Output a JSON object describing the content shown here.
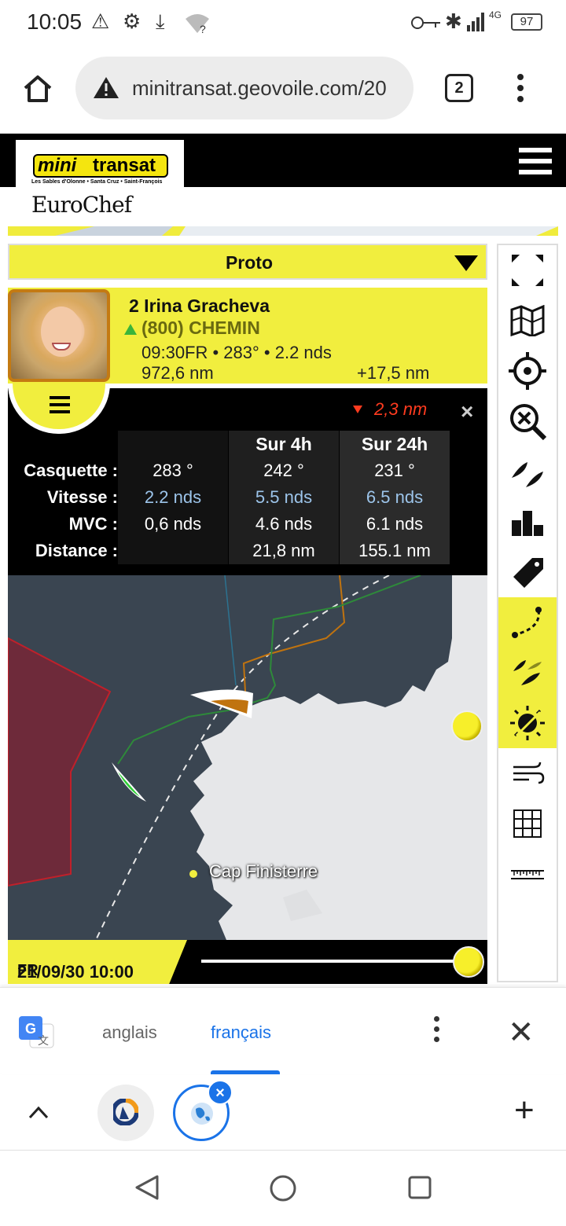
{
  "status_bar": {
    "time": "10:05",
    "battery": "97",
    "network": "4G"
  },
  "browser": {
    "url": "minitransat.geovoile.com/20",
    "tab_count": "2"
  },
  "site": {
    "logo_mini": "mini",
    "logo_transat": "transat",
    "logo_tagline": "Les Sables d'Olonne • Santa Cruz • Saint-François",
    "logo_sponsor": "EuroChef"
  },
  "class_selector": {
    "selected": "Proto"
  },
  "skipper": {
    "rank_name": "2 Irina Gracheva",
    "boat": "(800) CHEMIN",
    "position_line": "09:30FR • 283° • 2.2 nds",
    "distance": "972,6 nm",
    "gain": "+17,5 nm"
  },
  "stats": {
    "delta": "2,3 nm",
    "close": "×",
    "headers": [
      "",
      "Sur 4h",
      "Sur 24h"
    ],
    "rows": [
      {
        "label": "Casquette :",
        "values": [
          "283 °",
          "242 °",
          "231 °"
        ]
      },
      {
        "label": "Vitesse :",
        "values": [
          "2.2 nds",
          "5.5 nds",
          "6.5 nds"
        ]
      },
      {
        "label": "MVC :",
        "values": [
          "0,6 nds",
          "4.6 nds",
          "6.1 nds"
        ]
      },
      {
        "label": "Distance :",
        "values": [
          "",
          "21,8 nm",
          "155.1 nm"
        ]
      }
    ]
  },
  "map": {
    "place_label": "Cap Finisterre"
  },
  "timeline": {
    "date": "21/09/30 10:00",
    "tz": "FR",
    "position": 1.0
  },
  "toolbar": {
    "tools": [
      "fullscreen-icon",
      "map-icon",
      "crosshair-icon",
      "zoom-reset-icon",
      "boats-icon",
      "ranking-chart-icon",
      "tag-icon",
      "route-icon",
      "fleet-icon",
      "sun-icon",
      "wind-icon",
      "grid-icon",
      "scale-icon"
    ]
  },
  "translate_bar": {
    "lang_source": "anglais",
    "lang_target": "français"
  },
  "colors": {
    "brand_yellow": "#f1ee3e",
    "map_sea": "#3a4551",
    "map_land": "#e6e7e9",
    "zone_red": "#6e2a3a",
    "track_orange": "#c0730f",
    "track_green": "#2e8a3a",
    "accent_blue": "#1a73e8"
  }
}
